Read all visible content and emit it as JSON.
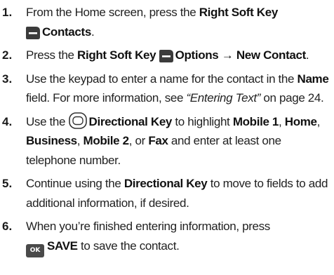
{
  "steps": [
    {
      "number": "1.",
      "parts": {
        "a": "From the Home screen, press the ",
        "b": "Right Soft Key",
        "c": "Contacts",
        "d": "."
      }
    },
    {
      "number": "2.",
      "parts": {
        "a": "Press the ",
        "b": "Right Soft Key",
        "c": "Options",
        "arrow": "→",
        "d": "New Contact",
        "e": "."
      }
    },
    {
      "number": "3.",
      "parts": {
        "a": "Use the keypad to enter a name for the contact in the ",
        "b": "Name",
        "c": " field. For more information, see ",
        "d": "“Entering Text”",
        "e": " on page 24."
      }
    },
    {
      "number": "4.",
      "parts": {
        "a": "Use the ",
        "b": "Directional Key",
        "c": " to highlight ",
        "d": "Mobile 1",
        "sep1": ", ",
        "e": "Home",
        "sep2": ", ",
        "f": "Business",
        "sep3": ", ",
        "g": "Mobile 2",
        "sep4": ", or ",
        "h": "Fax",
        "i": " and enter at least one telephone number."
      }
    },
    {
      "number": "5.",
      "parts": {
        "a": "Continue using the ",
        "b": "Directional Key",
        "c": " to move to fields to add additional information, if desired."
      }
    },
    {
      "number": "6.",
      "parts": {
        "a": "When you’re finished entering information, press ",
        "ok": "OK",
        "b": "SAVE",
        "c": " to save the contact."
      }
    }
  ],
  "icons": {
    "soft_key": "right-soft-key-icon",
    "directional": "directional-key-icon",
    "ok": "ok-key-icon"
  }
}
